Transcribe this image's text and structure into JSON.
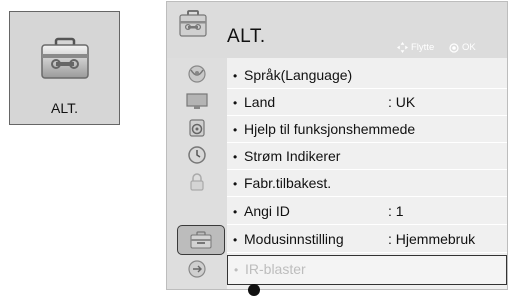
{
  "tile": {
    "label": "ALT.",
    "icon": "toolbox-icon"
  },
  "header": {
    "title": "ALT.",
    "hint_move_label": "Flytte",
    "hint_ok_label": "OK",
    "icon": "toolbox-icon"
  },
  "sidebar": {
    "categories": [
      {
        "name": "satellite-dish-icon"
      },
      {
        "name": "monitor-icon"
      },
      {
        "name": "speaker-icon"
      },
      {
        "name": "clock-icon"
      },
      {
        "name": "lock-icon"
      },
      {
        "name": "toolbox-icon",
        "active": true
      },
      {
        "name": "usb-icon"
      }
    ]
  },
  "menu": {
    "items": [
      {
        "label": "Språk(Language)",
        "value": ""
      },
      {
        "label": "Land",
        "value": ": UK"
      },
      {
        "label": "Hjelp til funksjonshemmede",
        "value": ""
      },
      {
        "label": "Strøm Indikerer",
        "value": ""
      },
      {
        "label": "Fabr.tilbakest.",
        "value": ""
      },
      {
        "label": "Angi ID",
        "value": ": 1"
      },
      {
        "label": "Modusinnstilling",
        "value": ": Hjemmebruk"
      },
      {
        "label": "IR-blaster",
        "value": "",
        "disabled": true,
        "highlighted": true
      }
    ]
  },
  "colors": {
    "panel_bg": "#e8e8e8",
    "header_bg": "#dcdcdc",
    "disabled_text": "#bdbdbd"
  }
}
